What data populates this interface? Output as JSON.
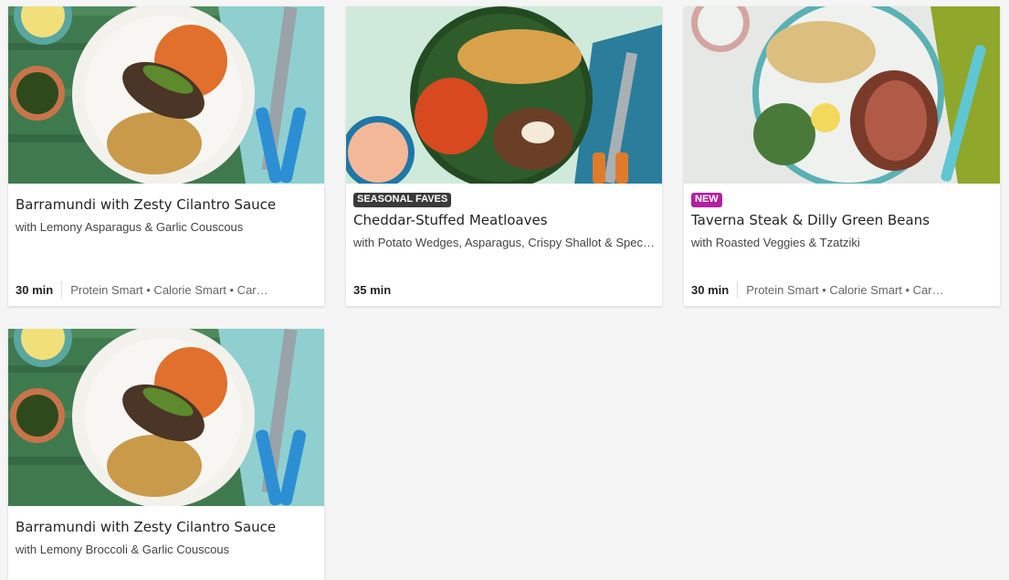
{
  "recipes": [
    {
      "title": "Barramundi with Zesty Cilantro Sauce",
      "subtitle": "with Lemony Asparagus & Garlic Couscous",
      "time": "30 min",
      "tags": "Protein Smart • Calorie Smart • Car…"
    },
    {
      "badge": "SEASONAL FAVES",
      "title": "Cheddar-Stuffed Meatloaves",
      "subtitle": "with Potato Wedges, Asparagus, Crispy Shallot & Specia…",
      "time": "35 min"
    },
    {
      "badge": "NEW",
      "title": "Taverna Steak & Dilly Green Beans",
      "subtitle": "with Roasted Veggies & Tzatziki",
      "time": "30 min",
      "tags": "Protein Smart • Calorie Smart • Car…"
    },
    {
      "title": "Barramundi with Zesty Cilantro Sauce",
      "subtitle": "with Lemony Broccoli & Garlic Couscous"
    }
  ],
  "colors": {
    "badge_dark": "#3a3a3a",
    "badge_new": "#b51f9d",
    "text": "#242424"
  }
}
